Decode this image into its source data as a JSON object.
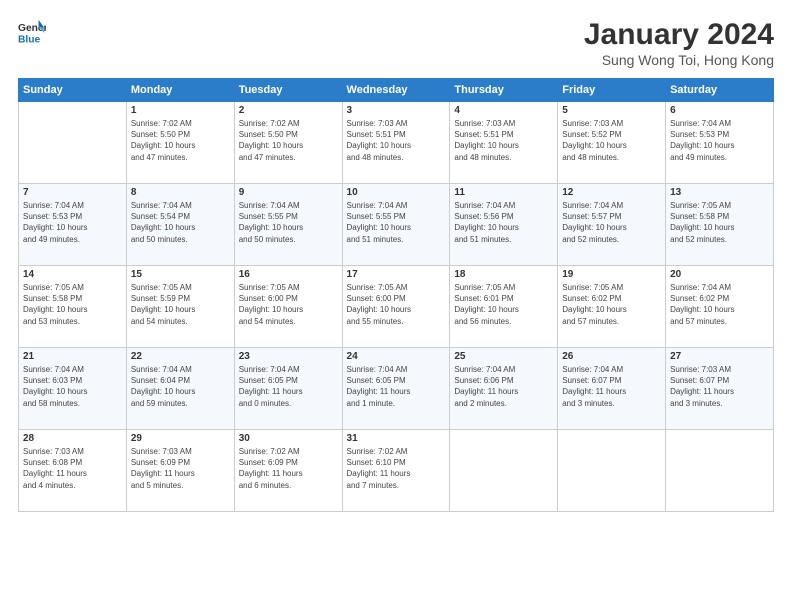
{
  "header": {
    "logo_line1": "General",
    "logo_line2": "Blue",
    "month_year": "January 2024",
    "location": "Sung Wong Toi, Hong Kong"
  },
  "weekdays": [
    "Sunday",
    "Monday",
    "Tuesday",
    "Wednesday",
    "Thursday",
    "Friday",
    "Saturday"
  ],
  "weeks": [
    [
      {
        "day": "",
        "info": ""
      },
      {
        "day": "1",
        "info": "Sunrise: 7:02 AM\nSunset: 5:50 PM\nDaylight: 10 hours\nand 47 minutes."
      },
      {
        "day": "2",
        "info": "Sunrise: 7:02 AM\nSunset: 5:50 PM\nDaylight: 10 hours\nand 47 minutes."
      },
      {
        "day": "3",
        "info": "Sunrise: 7:03 AM\nSunset: 5:51 PM\nDaylight: 10 hours\nand 48 minutes."
      },
      {
        "day": "4",
        "info": "Sunrise: 7:03 AM\nSunset: 5:51 PM\nDaylight: 10 hours\nand 48 minutes."
      },
      {
        "day": "5",
        "info": "Sunrise: 7:03 AM\nSunset: 5:52 PM\nDaylight: 10 hours\nand 48 minutes."
      },
      {
        "day": "6",
        "info": "Sunrise: 7:04 AM\nSunset: 5:53 PM\nDaylight: 10 hours\nand 49 minutes."
      }
    ],
    [
      {
        "day": "7",
        "info": "Sunrise: 7:04 AM\nSunset: 5:53 PM\nDaylight: 10 hours\nand 49 minutes."
      },
      {
        "day": "8",
        "info": "Sunrise: 7:04 AM\nSunset: 5:54 PM\nDaylight: 10 hours\nand 50 minutes."
      },
      {
        "day": "9",
        "info": "Sunrise: 7:04 AM\nSunset: 5:55 PM\nDaylight: 10 hours\nand 50 minutes."
      },
      {
        "day": "10",
        "info": "Sunrise: 7:04 AM\nSunset: 5:55 PM\nDaylight: 10 hours\nand 51 minutes."
      },
      {
        "day": "11",
        "info": "Sunrise: 7:04 AM\nSunset: 5:56 PM\nDaylight: 10 hours\nand 51 minutes."
      },
      {
        "day": "12",
        "info": "Sunrise: 7:04 AM\nSunset: 5:57 PM\nDaylight: 10 hours\nand 52 minutes."
      },
      {
        "day": "13",
        "info": "Sunrise: 7:05 AM\nSunset: 5:58 PM\nDaylight: 10 hours\nand 52 minutes."
      }
    ],
    [
      {
        "day": "14",
        "info": "Sunrise: 7:05 AM\nSunset: 5:58 PM\nDaylight: 10 hours\nand 53 minutes."
      },
      {
        "day": "15",
        "info": "Sunrise: 7:05 AM\nSunset: 5:59 PM\nDaylight: 10 hours\nand 54 minutes."
      },
      {
        "day": "16",
        "info": "Sunrise: 7:05 AM\nSunset: 6:00 PM\nDaylight: 10 hours\nand 54 minutes."
      },
      {
        "day": "17",
        "info": "Sunrise: 7:05 AM\nSunset: 6:00 PM\nDaylight: 10 hours\nand 55 minutes."
      },
      {
        "day": "18",
        "info": "Sunrise: 7:05 AM\nSunset: 6:01 PM\nDaylight: 10 hours\nand 56 minutes."
      },
      {
        "day": "19",
        "info": "Sunrise: 7:05 AM\nSunset: 6:02 PM\nDaylight: 10 hours\nand 57 minutes."
      },
      {
        "day": "20",
        "info": "Sunrise: 7:04 AM\nSunset: 6:02 PM\nDaylight: 10 hours\nand 57 minutes."
      }
    ],
    [
      {
        "day": "21",
        "info": "Sunrise: 7:04 AM\nSunset: 6:03 PM\nDaylight: 10 hours\nand 58 minutes."
      },
      {
        "day": "22",
        "info": "Sunrise: 7:04 AM\nSunset: 6:04 PM\nDaylight: 10 hours\nand 59 minutes."
      },
      {
        "day": "23",
        "info": "Sunrise: 7:04 AM\nSunset: 6:05 PM\nDaylight: 11 hours\nand 0 minutes."
      },
      {
        "day": "24",
        "info": "Sunrise: 7:04 AM\nSunset: 6:05 PM\nDaylight: 11 hours\nand 1 minute."
      },
      {
        "day": "25",
        "info": "Sunrise: 7:04 AM\nSunset: 6:06 PM\nDaylight: 11 hours\nand 2 minutes."
      },
      {
        "day": "26",
        "info": "Sunrise: 7:04 AM\nSunset: 6:07 PM\nDaylight: 11 hours\nand 3 minutes."
      },
      {
        "day": "27",
        "info": "Sunrise: 7:03 AM\nSunset: 6:07 PM\nDaylight: 11 hours\nand 3 minutes."
      }
    ],
    [
      {
        "day": "28",
        "info": "Sunrise: 7:03 AM\nSunset: 6:08 PM\nDaylight: 11 hours\nand 4 minutes."
      },
      {
        "day": "29",
        "info": "Sunrise: 7:03 AM\nSunset: 6:09 PM\nDaylight: 11 hours\nand 5 minutes."
      },
      {
        "day": "30",
        "info": "Sunrise: 7:02 AM\nSunset: 6:09 PM\nDaylight: 11 hours\nand 6 minutes."
      },
      {
        "day": "31",
        "info": "Sunrise: 7:02 AM\nSunset: 6:10 PM\nDaylight: 11 hours\nand 7 minutes."
      },
      {
        "day": "",
        "info": ""
      },
      {
        "day": "",
        "info": ""
      },
      {
        "day": "",
        "info": ""
      }
    ]
  ]
}
